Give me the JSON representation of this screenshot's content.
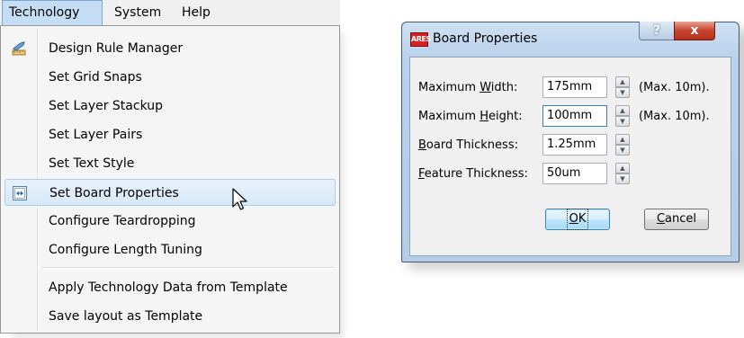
{
  "menubar": {
    "items": [
      {
        "label": "Technology",
        "active": true
      },
      {
        "label": "System",
        "active": false
      },
      {
        "label": "Help",
        "active": false
      }
    ]
  },
  "menu": {
    "items": [
      {
        "label": "Design Rule Manager",
        "icon": "design-rules-icon"
      },
      {
        "label": "Set Grid Snaps"
      },
      {
        "label": "Set Layer Stackup"
      },
      {
        "label": "Set Layer Pairs"
      },
      {
        "label": "Set Text Style"
      },
      {
        "label": "Set Board Properties",
        "icon": "board-properties-icon",
        "highlighted": true
      },
      {
        "label": "Configure Teardropping"
      },
      {
        "label": "Configure Length Tuning"
      },
      {
        "label": "Apply Technology Data from Template"
      },
      {
        "label": "Save layout as Template"
      }
    ]
  },
  "dialog": {
    "title": "Board Properties",
    "app_icon_text": "ARES",
    "help_button": "?",
    "close_button": "x",
    "fields": [
      {
        "label_pre": "Maximum ",
        "label_ul": "W",
        "label_post": "idth:",
        "value": "175mm",
        "note": "(Max. 10m)."
      },
      {
        "label_pre": "Maximum ",
        "label_ul": "H",
        "label_post": "eight:",
        "value": "100mm",
        "note": "(Max. 10m).",
        "focused": true
      },
      {
        "label_pre": "",
        "label_ul": "B",
        "label_post": "oard Thickness:",
        "value": "1.25mm",
        "note": ""
      },
      {
        "label_pre": "",
        "label_ul": "F",
        "label_post": "eature Thickness:",
        "value": "50um",
        "note": ""
      }
    ],
    "ok_ul": "O",
    "ok_rest": "K",
    "cancel_ul": "C",
    "cancel_rest": "ancel"
  },
  "colors": {
    "menu_highlight": "#d8e8f8",
    "menubar_active": "#c5def5",
    "dialog_frame": "#b9d1ea",
    "close_red": "#c8442d"
  }
}
